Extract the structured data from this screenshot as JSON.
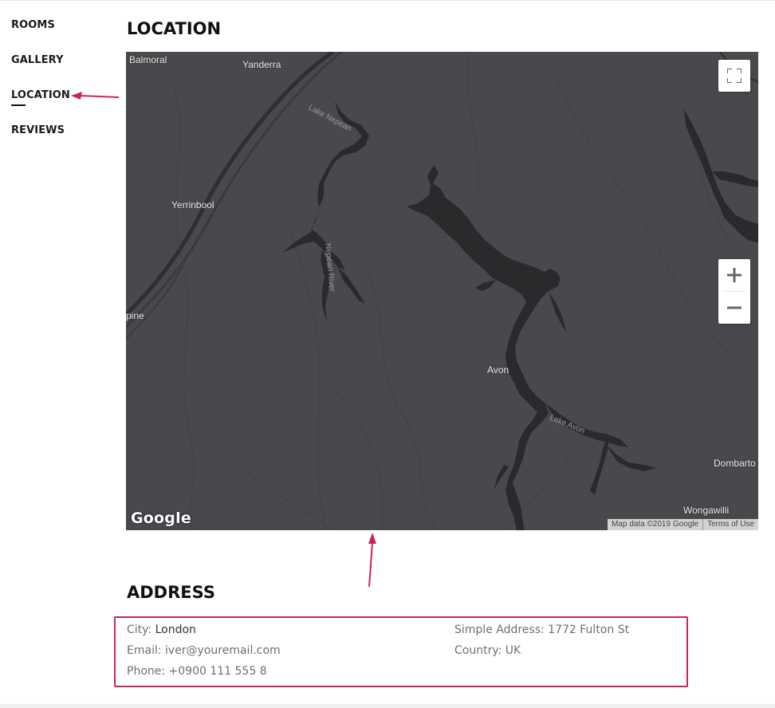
{
  "nav": {
    "items": [
      {
        "label": "ROOMS"
      },
      {
        "label": "GALLERY"
      },
      {
        "label": "LOCATION",
        "active": true
      },
      {
        "label": "REVIEWS"
      }
    ]
  },
  "location": {
    "title": "LOCATION",
    "map": {
      "places": [
        "Balmoral",
        "Yanderra",
        "Yerrinbool",
        "pine",
        "Avon",
        "Dombarto",
        "Wongawilli"
      ],
      "lake_labels": [
        "Lake Nepean",
        "Lake Avon",
        "Nepean River"
      ],
      "logo": "Google",
      "attribution": "Map data ©2019 Google",
      "terms": "Terms of Use",
      "zoom_in_label": "+",
      "zoom_out_label": "−",
      "icons": {
        "fullscreen": "fullscreen-icon"
      }
    }
  },
  "address": {
    "title": "ADDRESS",
    "city_label": "City: ",
    "city_value": "London",
    "email_label": "Email: ",
    "email_value": "iver@youremail.com",
    "phone_label": "Phone: ",
    "phone_value": "+0900 111 555 8",
    "simple_address_label": "Simple Address: ",
    "simple_address_value": "1772 Fulton St",
    "country_label": "Country: ",
    "country_value": "UK"
  },
  "colors": {
    "annotation": "#c82657",
    "map_bg": "#48494d",
    "water": "#2a2a2c"
  }
}
